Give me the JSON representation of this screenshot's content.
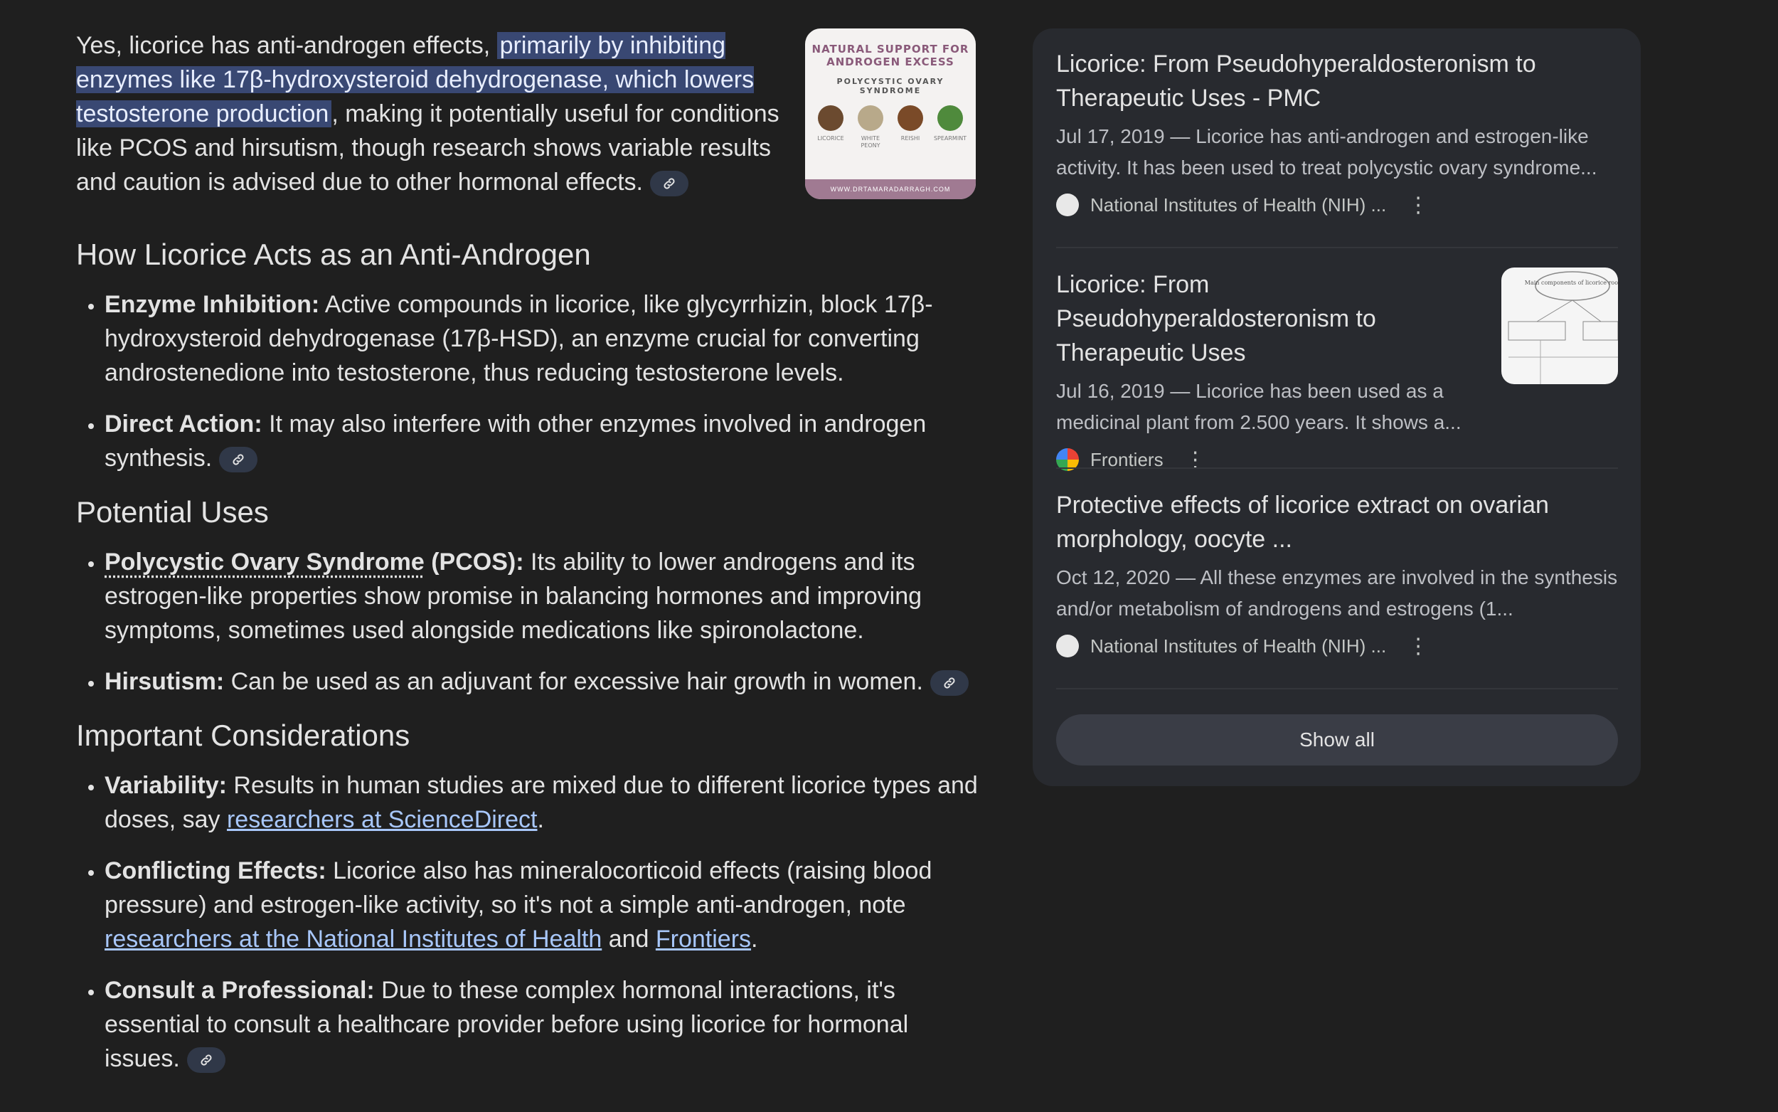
{
  "intro": {
    "text_before": "Yes, licorice has anti-androgen effects, ",
    "highlight": "primarily by inhibiting enzymes like 17β-hydroxysteroid dehydrogenase, which lowers testosterone production",
    "text_after": ", making it potentially useful for conditions like PCOS and hirsutism, though research shows variable results and caution is advised due to other hormonal effects."
  },
  "thumbnail": {
    "title": "NATURAL SUPPORT FOR ANDROGEN EXCESS",
    "subtitle": "POLYCYSTIC OVARY SYNDROME",
    "herbs": [
      {
        "name": "LICORICE",
        "color": "#6b4a2f"
      },
      {
        "name": "WHITE PEONY",
        "color": "#b8a98a"
      },
      {
        "name": "REISHI",
        "color": "#7a4a28"
      },
      {
        "name": "SPEARMINT",
        "color": "#4f8a3c"
      }
    ],
    "footer": "WWW.DRTAMARADARRAGH.COM"
  },
  "sections": {
    "acts": {
      "heading": "How Licorice Acts as an Anti-Androgen",
      "items": [
        {
          "term": "Enzyme Inhibition:",
          "text": " Active compounds in licorice, like glycyrrhizin, block 17β-hydroxysteroid dehydrogenase (17β-HSD), an enzyme crucial for converting androstenedione into testosterone, thus reducing testosterone levels."
        },
        {
          "term": "Direct Action:",
          "text": " It may also interfere with other enzymes involved in androgen synthesis."
        }
      ]
    },
    "uses": {
      "heading": "Potential Uses",
      "items": [
        {
          "term_link": "Polycystic Ovary Syndrome",
          "term": " (PCOS):",
          "text": " Its ability to lower androgens and its estrogen-like properties show promise in balancing hormones and improving symptoms, sometimes used alongside medications like spironolactone."
        },
        {
          "term": "Hirsutism:",
          "text": " Can be used as an adjuvant for excessive hair growth in women."
        }
      ]
    },
    "considerations": {
      "heading": "Important Considerations",
      "items": [
        {
          "term": "Variability:",
          "text": " Results in human studies are mixed due to different licorice types and doses, say ",
          "link": "researchers at ScienceDirect",
          "tail": "."
        },
        {
          "term": "Conflicting Effects:",
          "text": " Licorice also has mineralocorticoid effects (raising blood pressure) and estrogen-like activity, so it's not a simple anti-androgen, note ",
          "link": "researchers at the National Institutes of Health",
          "mid": " and ",
          "link2": "Frontiers",
          "tail": "."
        },
        {
          "term": "Consult a Professional:",
          "text": " Due to these complex hormonal interactions, it's essential to consult a healthcare provider before using licorice for hormonal issues."
        }
      ]
    }
  },
  "sources": [
    {
      "title": "Licorice: From Pseudohyperaldosteronism to Therapeutic Uses - PMC",
      "snippet": "Jul 17, 2019 — Licorice has anti-androgen and estrogen-like activity. It has been used to treat polycystic ovary syndrome...",
      "site": "National Institutes of Health (NIH) ..."
    },
    {
      "title": "Licorice: From Pseudohyperaldosteronism to Therapeutic Uses",
      "snippet": "Jul 16, 2019 — Licorice has been used as a medicinal plant from 2.500 years. It shows a...",
      "site": "Frontiers",
      "thumb_label": "Main components of licorice root"
    },
    {
      "title": "Protective effects of licorice extract on ovarian morphology, oocyte ...",
      "snippet": "Oct 12, 2020 — All these enzymes are involved in the synthesis and/or metabolism of androgens and estrogens (1...",
      "site": "National Institutes of Health (NIH) ..."
    }
  ],
  "show_all": "Show all",
  "colors": {
    "background": "#1f1f1f",
    "panel": "#282a2f",
    "highlight": "#394873",
    "link": "#a8c7fa"
  }
}
